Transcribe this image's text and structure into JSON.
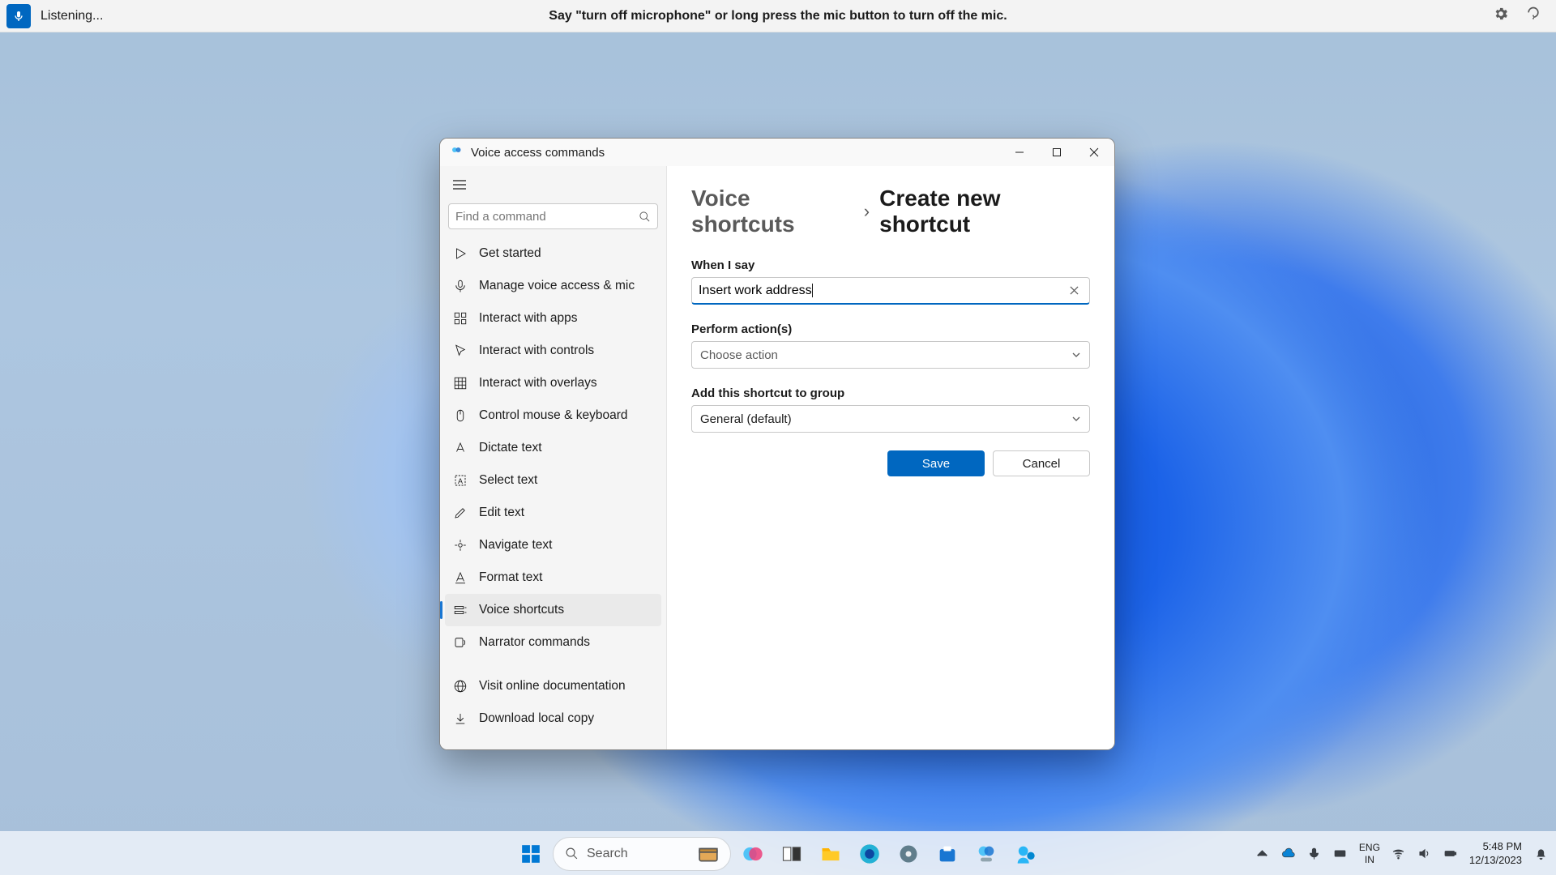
{
  "voice_bar": {
    "status": "Listening...",
    "hint": "Say \"turn off microphone\" or long press the mic button to turn off the mic."
  },
  "window": {
    "title": "Voice access commands"
  },
  "sidebar": {
    "search_placeholder": "Find a command",
    "items": [
      {
        "label": "Get started"
      },
      {
        "label": "Manage voice access & mic"
      },
      {
        "label": "Interact with apps"
      },
      {
        "label": "Interact with controls"
      },
      {
        "label": "Interact with overlays"
      },
      {
        "label": "Control mouse & keyboard"
      },
      {
        "label": "Dictate text"
      },
      {
        "label": "Select text"
      },
      {
        "label": "Edit text"
      },
      {
        "label": "Navigate text"
      },
      {
        "label": "Format text"
      },
      {
        "label": "Voice shortcuts"
      },
      {
        "label": "Narrator commands"
      }
    ],
    "footer": [
      {
        "label": "Visit online documentation"
      },
      {
        "label": "Download local copy"
      }
    ]
  },
  "main": {
    "crumb_link": "Voice shortcuts",
    "crumb_current": "Create new shortcut",
    "when_i_say_label": "When I say",
    "when_i_say_value": "Insert work address",
    "perform_label": "Perform action(s)",
    "perform_placeholder": "Choose action",
    "group_label": "Add this shortcut to group",
    "group_value": "General (default)",
    "save": "Save",
    "cancel": "Cancel"
  },
  "taskbar": {
    "search": "Search",
    "lang1": "ENG",
    "lang2": "IN",
    "time": "5:48 PM",
    "date": "12/13/2023"
  }
}
